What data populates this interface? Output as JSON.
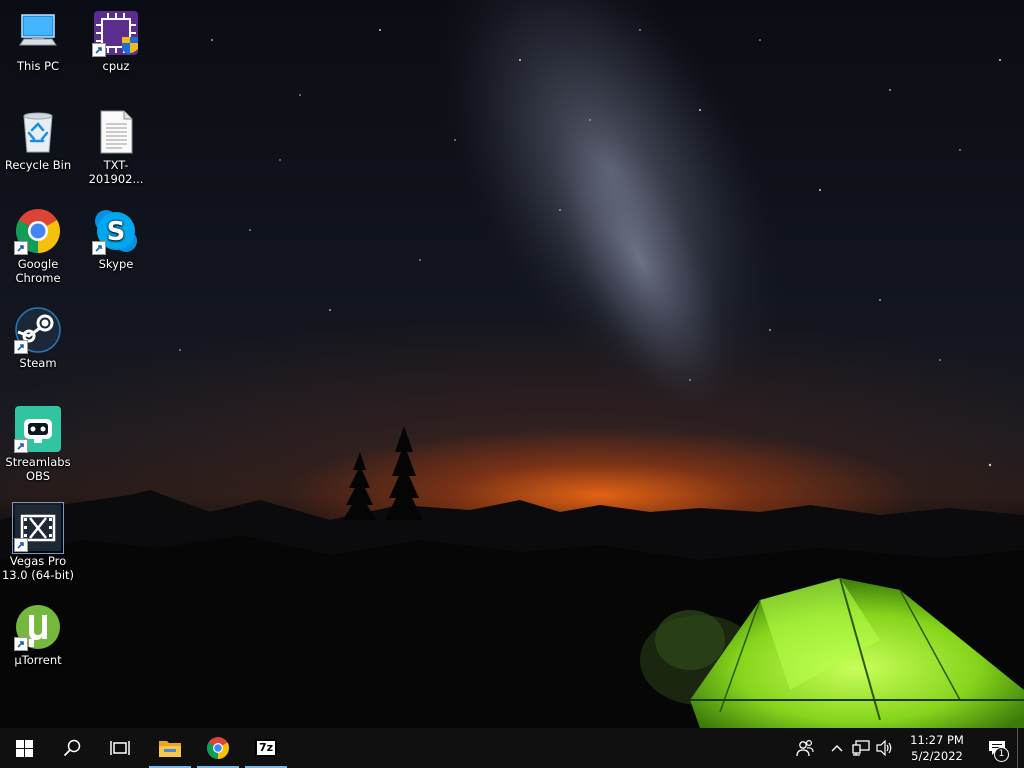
{
  "desktop": {
    "icons": [
      {
        "label": "This PC",
        "icon": "computer-icon",
        "shortcut": false
      },
      {
        "label": "cpuz",
        "icon": "cpuz-icon",
        "shortcut": true
      },
      {
        "label": "Recycle Bin",
        "icon": "recycle-bin-icon",
        "shortcut": false
      },
      {
        "label": "TXT-201902...",
        "icon": "text-file-icon",
        "shortcut": false
      },
      {
        "label": "Google Chrome",
        "icon": "chrome-icon",
        "shortcut": true
      },
      {
        "label": "Skype",
        "icon": "skype-icon",
        "shortcut": true
      },
      {
        "label": "Steam",
        "icon": "steam-icon",
        "shortcut": true
      },
      {
        "label": "Streamlabs OBS",
        "icon": "streamlabs-obs-icon",
        "shortcut": true
      },
      {
        "label": "Vegas Pro 13.0 (64-bit)",
        "icon": "vegas-pro-icon",
        "shortcut": true
      },
      {
        "label": "µTorrent",
        "icon": "utorrent-icon",
        "shortcut": true
      }
    ]
  },
  "taskbar": {
    "start": "windows-start-icon",
    "search": "search-icon",
    "task_view": "task-view-icon",
    "pinned": [
      {
        "icon": "file-explorer-icon",
        "running": true
      },
      {
        "icon": "chrome-icon",
        "running": true
      },
      {
        "icon": "7zip-icon",
        "running": true,
        "text": "7z"
      }
    ],
    "tray": {
      "icons": [
        "people-icon",
        "chevron-up-icon",
        "network-icon",
        "volume-icon"
      ],
      "time": "11:27 PM",
      "date": "5/2/2022",
      "notification_count": "1"
    }
  },
  "colors": {
    "taskbar_bg": "#101010",
    "running_indicator": "#76b9ed",
    "tent_green": "#7ed321"
  }
}
